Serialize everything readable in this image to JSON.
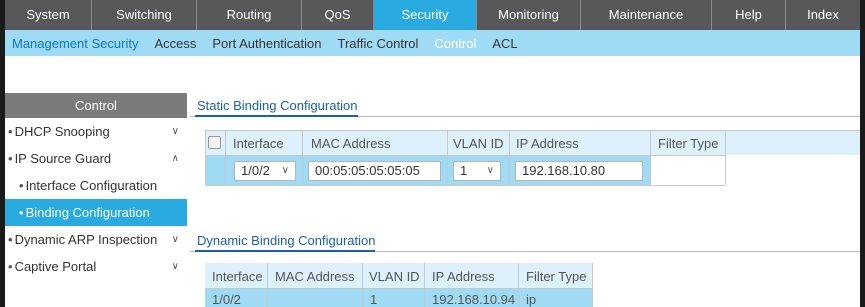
{
  "topnav": {
    "tabs": [
      "System",
      "Switching",
      "Routing",
      "QoS",
      "Security",
      "Monitoring",
      "Maintenance",
      "Help",
      "Index"
    ],
    "active": "Security"
  },
  "subnav": {
    "items": [
      "Management Security",
      "Access",
      "Port Authentication",
      "Traffic Control",
      "Control",
      "ACL"
    ]
  },
  "sidebar": {
    "header": "Control",
    "items": {
      "dhcp_snooping": "DHCP Snooping",
      "ip_source_guard": "IP Source Guard",
      "interface_configuration": "Interface Configuration",
      "binding_configuration": "Binding Configuration",
      "dynamic_arp_inspection": "Dynamic ARP Inspection",
      "captive_portal": "Captive Portal"
    }
  },
  "static_binding": {
    "title": "Static Binding Configuration",
    "headers": {
      "interface": "Interface",
      "mac_address": "MAC Address",
      "vlan_id": "VLAN ID",
      "ip_address": "IP Address",
      "filter_type": "Filter Type"
    },
    "row": {
      "interface": "1/0/2",
      "mac_address": "00:05:05:05:05:05",
      "vlan_id": "1",
      "ip_address": "192.168.10.80"
    }
  },
  "dynamic_binding": {
    "title": "Dynamic Binding Configuration",
    "headers": {
      "interface": "Interface",
      "mac_address": "MAC Address",
      "vlan_id": "VLAN ID",
      "ip_address": "IP Address",
      "filter_type": "Filter Type"
    },
    "row": {
      "interface": "1/0/2",
      "mac_address": "",
      "vlan_id": "1",
      "ip_address": "192.168.10.94",
      "filter_type": "ip"
    }
  },
  "colors": {
    "topnav_bg": "#58585a",
    "active_tab": "#29abe2",
    "subnav_bg": "#a0dbf6",
    "link_blue": "#1b5fa8",
    "sidebar_header": "#7b7b7b",
    "table_header_bg": "#dcf1fb",
    "row_bg": "#a0dbf6"
  }
}
